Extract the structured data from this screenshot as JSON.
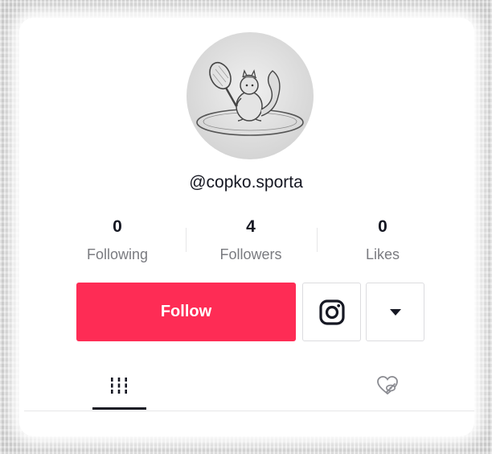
{
  "profile": {
    "username": "@copko.sporta"
  },
  "stats": [
    {
      "value": "0",
      "label": "Following"
    },
    {
      "value": "4",
      "label": "Followers"
    },
    {
      "value": "0",
      "label": "Likes"
    }
  ],
  "actions": {
    "follow_label": "Follow",
    "instagram_icon": "instagram-icon",
    "more_icon": "caret-down-icon"
  },
  "tabs": [
    {
      "icon": "grid-icon",
      "active": true
    },
    {
      "icon": "liked-hidden-icon",
      "active": false
    }
  ],
  "colors": {
    "accent": "#fe2c55",
    "text": "#161823",
    "muted": "#7a7b80"
  }
}
